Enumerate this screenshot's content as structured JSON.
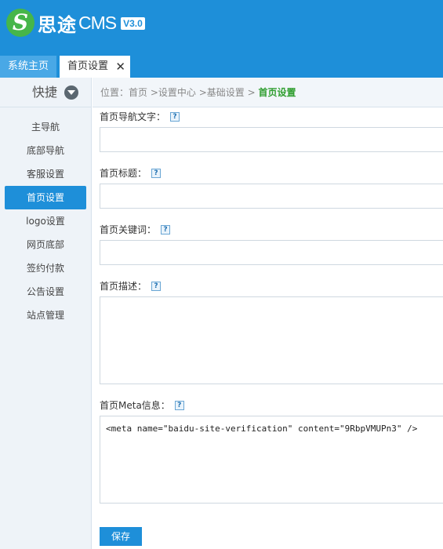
{
  "app": {
    "logo_letter": "S",
    "logo_cn": "思途",
    "logo_cms": "CMS",
    "version": "V3.0"
  },
  "tabs": [
    {
      "label": "系统主页"
    },
    {
      "label": "首页设置",
      "close": "✕"
    }
  ],
  "sidebar": {
    "quick_label": "快捷",
    "items": [
      {
        "label": "主导航"
      },
      {
        "label": "底部导航"
      },
      {
        "label": "客服设置"
      },
      {
        "label": "首页设置"
      },
      {
        "label": "logo设置"
      },
      {
        "label": "网页底部"
      },
      {
        "label": "签约付款"
      },
      {
        "label": "公告设置"
      },
      {
        "label": "站点管理"
      }
    ]
  },
  "breadcrumb": {
    "prefix": "位置：",
    "path": "首页 >设置中心 >基础设置 > ",
    "current": "首页设置"
  },
  "form": {
    "nav_text_label": "首页导航文字：",
    "title_label": "首页标题：",
    "keywords_label": "首页关键词：",
    "description_label": "首页描述：",
    "meta_label": "首页Meta信息：",
    "meta_value": "<meta name=\"baidu-site-verification\" content=\"9RbpVMUPn3\" />",
    "help_glyph": "?",
    "save_label": "保存"
  }
}
